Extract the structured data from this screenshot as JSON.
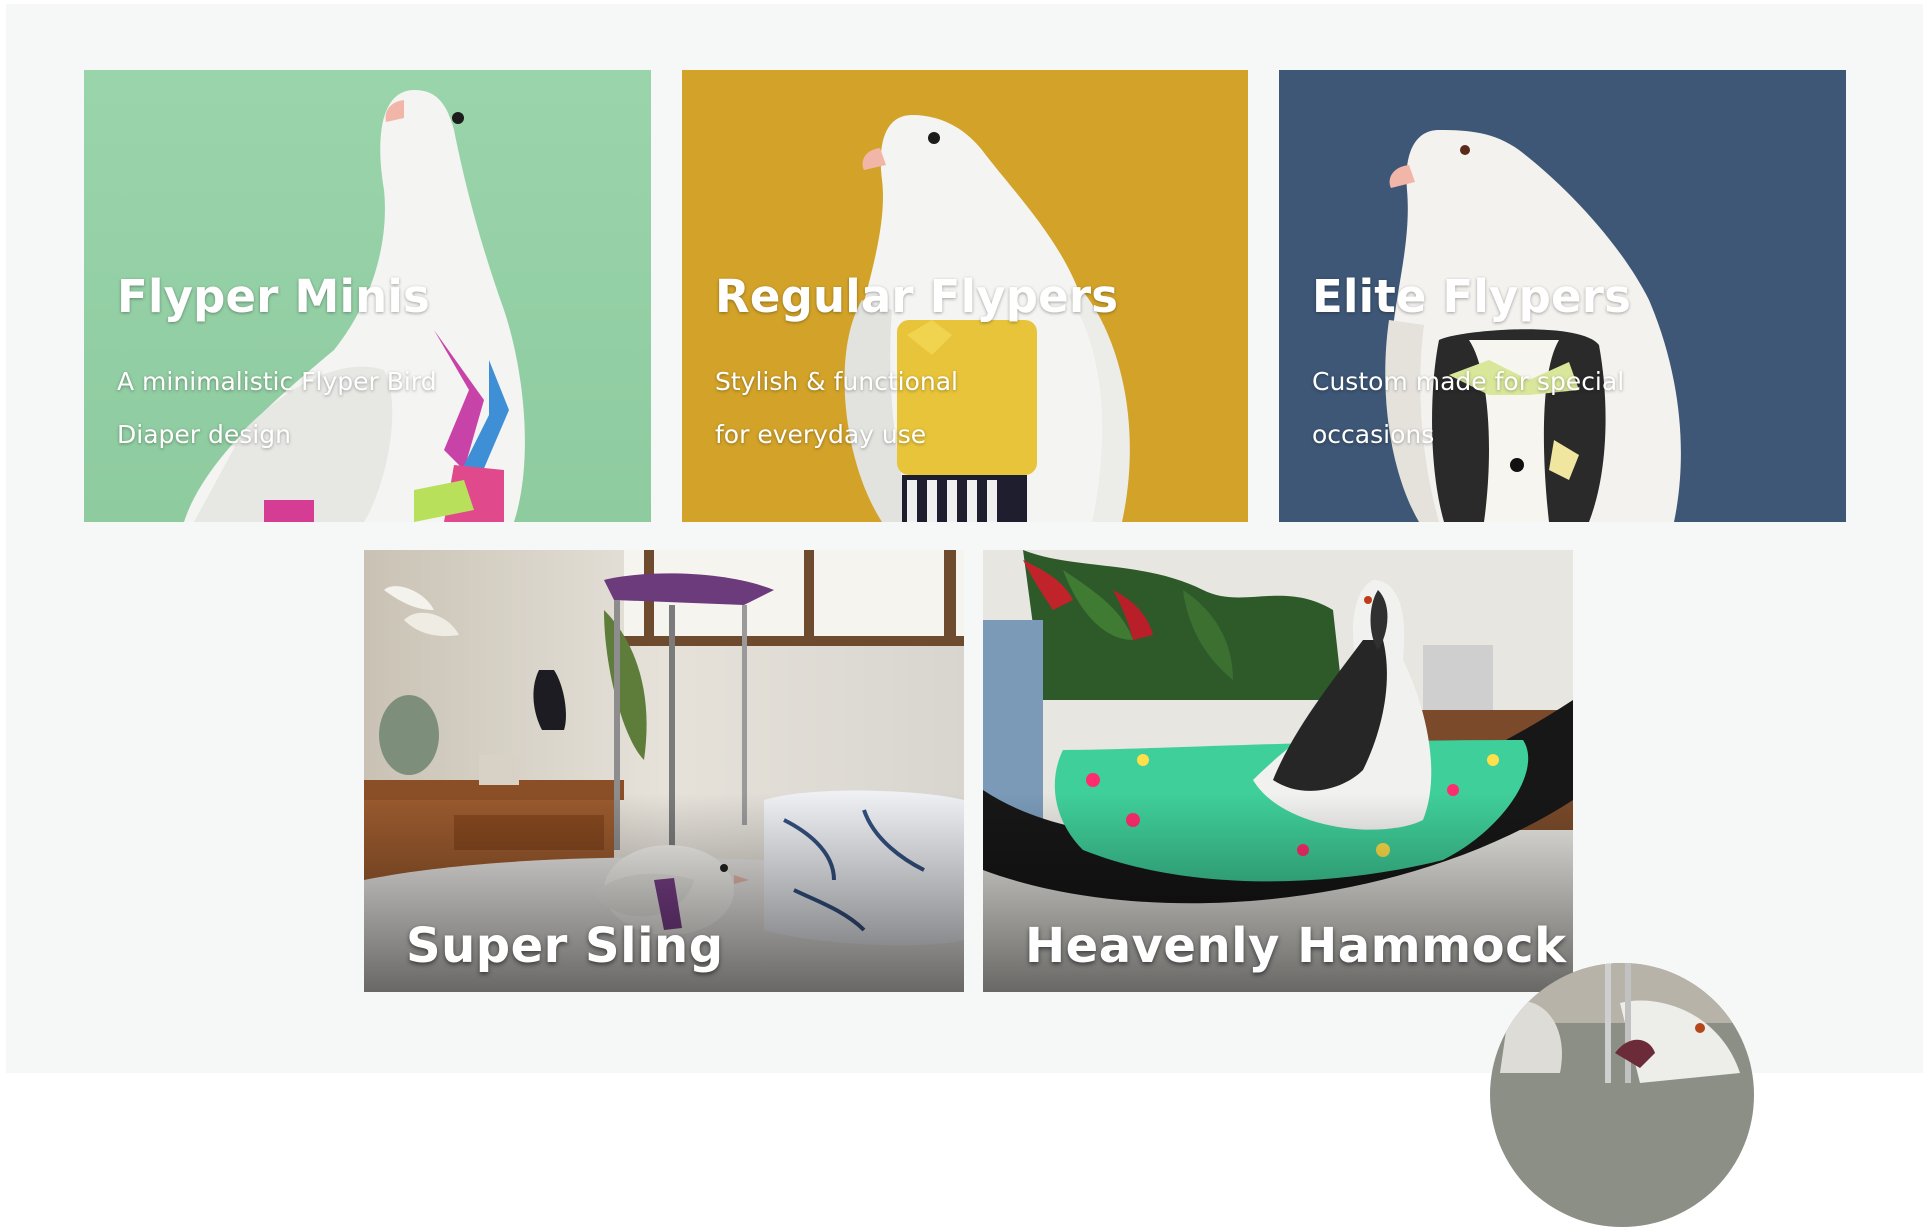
{
  "cards": [
    {
      "title": "Flyper Minis",
      "description_line1": "A minimalistic Flyper Bird",
      "description_line2": "Diaper design",
      "background_color": "#94cfa5"
    },
    {
      "title": "Regular Flypers",
      "description_line1": "Stylish & functional",
      "description_line2": "for everyday use",
      "background_color": "#d4a42a"
    },
    {
      "title": "Elite Flypers",
      "description_line1": "Custom made for special",
      "description_line2": "occasions",
      "background_color": "#3f5877"
    }
  ],
  "photos": [
    {
      "title": "Super Sling"
    },
    {
      "title": "Heavenly Hammock"
    }
  ],
  "colors": {
    "page_background": "#f6f7f7",
    "text": "#ffffff"
  }
}
